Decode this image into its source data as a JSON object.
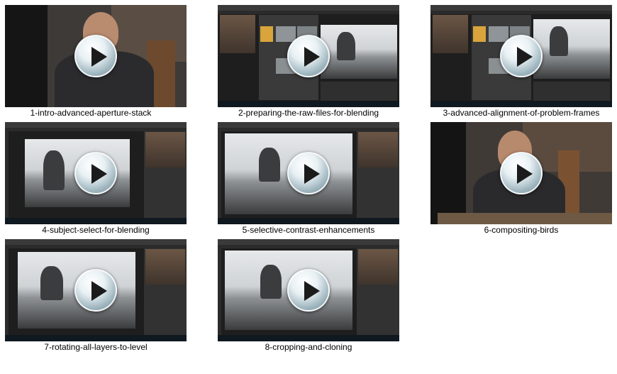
{
  "items": [
    {
      "label": "1-intro-advanced-aperture-stack"
    },
    {
      "label": "2-preparing-the-raw-files-for-blending"
    },
    {
      "label": "3-advanced-alignment-of-problem-frames"
    },
    {
      "label": "4-subject-select-for-blending"
    },
    {
      "label": "5-selective-contrast-enhancements"
    },
    {
      "label": "6-compositing-birds"
    },
    {
      "label": "7-rotating-all-layers-to-level"
    },
    {
      "label": "8-cropping-and-cloning"
    }
  ],
  "icons": {
    "play": "play-icon"
  },
  "colors": {
    "background": "#ffffff",
    "ps_dark": "#2b2b2b",
    "label_text": "#000000"
  }
}
